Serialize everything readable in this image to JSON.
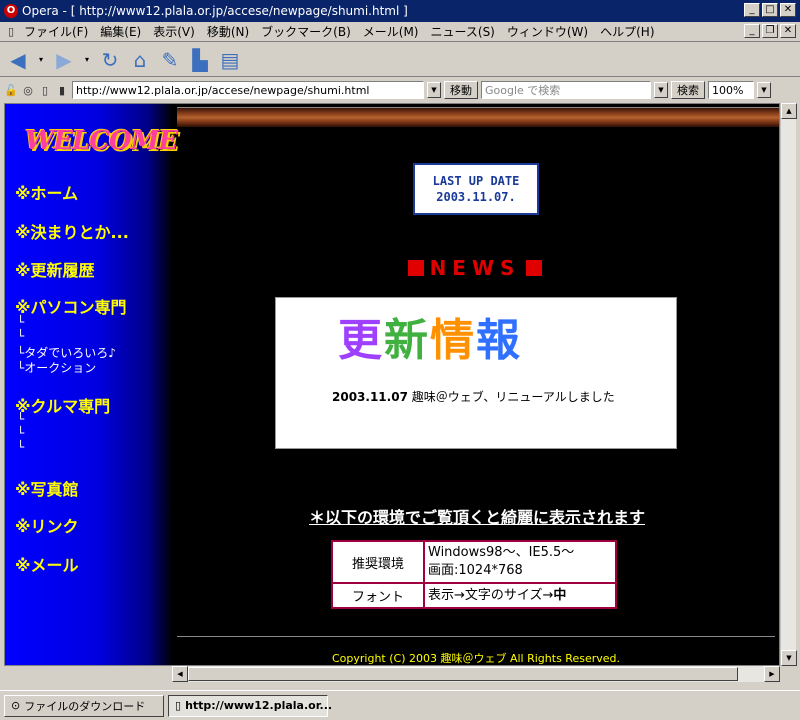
{
  "window": {
    "title": "Opera - [ http://www12.plala.or.jp/accese/newpage/shumi.html ]",
    "app_icon": "opera-icon",
    "buttons": [
      "minimize",
      "maximize",
      "close"
    ]
  },
  "menu": {
    "items": [
      "ファイル(F)",
      "編集(E)",
      "表示(V)",
      "移動(N)",
      "ブックマーク(B)",
      "メール(M)",
      "ニュース(S)",
      "ウィンドウ(W)",
      "ヘルプ(H)"
    ]
  },
  "toolbar": {
    "buttons": [
      "back",
      "forward",
      "reload",
      "home",
      "hotlist",
      "print",
      "print-preview"
    ]
  },
  "address": {
    "url": "http://www12.plala.or.jp/accese/newpage/shumi.html",
    "go_label": "移動",
    "search_placeholder": "Google で検索",
    "search_label": "検索",
    "zoom": "100%"
  },
  "page": {
    "sidebar": {
      "welcome": "WELCOME",
      "nav": [
        "※ホーム",
        "※決まりとか...",
        "※更新履歴",
        "※パソコン専門",
        "※クルマ専門",
        "※写真館",
        "※リンク",
        "※メール"
      ],
      "pc_sub": [
        "└",
        "└",
        "└タダでいろいろ♪",
        "└オークション"
      ],
      "car_sub": [
        "└",
        "└",
        "└"
      ]
    },
    "lastup": {
      "line1": "LAST UP DATE",
      "line2": "2003.11.07."
    },
    "news_title": "NEWS",
    "koushin": [
      "更",
      "新",
      "情",
      "報"
    ],
    "news_entry": {
      "date": "2003.11.07",
      "text": "趣味＠ウェブ、リニューアルしました"
    },
    "env_header": "＊以下の環境でご覧頂くと綺麗に表示されます",
    "env": {
      "label1": "推奨環境",
      "value1a": "Windows98〜、IE5.5〜",
      "value1b": "画面:1024*768",
      "label2": "フォント",
      "value2": "表示→文字のサイズ→",
      "value2b": "中"
    },
    "copyright": "Copyright (C) 2003 趣味＠ウェブ All Rights Reserved."
  },
  "status": {
    "tab1": "ファイルのダウンロード",
    "tab2": "http://www12.plala.or..."
  },
  "colors": {
    "titlebar": "#0a246a",
    "sidebar_blue": "#0000ff",
    "nav_yellow": "#ffff00",
    "news_red": "#e00000"
  }
}
